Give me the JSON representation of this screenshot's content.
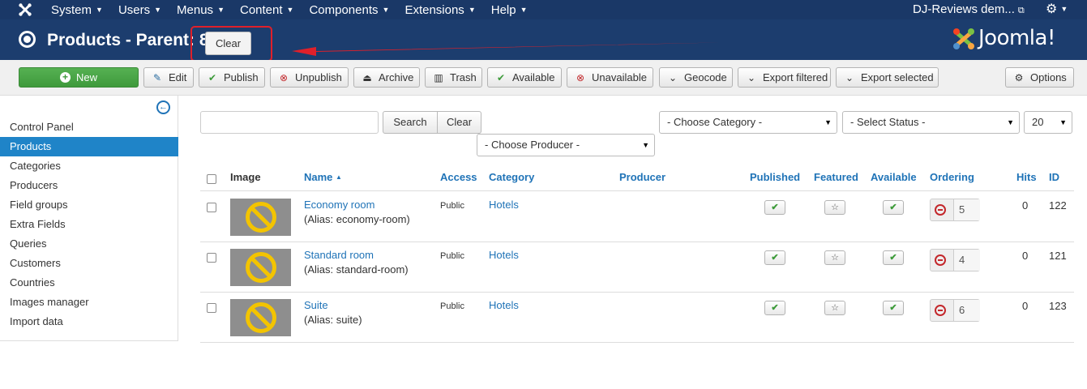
{
  "topnav": {
    "menu": [
      {
        "label": "System"
      },
      {
        "label": "Users"
      },
      {
        "label": "Menus"
      },
      {
        "label": "Content"
      },
      {
        "label": "Components"
      },
      {
        "label": "Extensions"
      },
      {
        "label": "Help"
      }
    ],
    "site_label": "DJ-Reviews dem...",
    "bg_color": "#1a3867"
  },
  "header": {
    "title": "Products - Parent: 89",
    "clear_label": "Clear",
    "logo_text": "Joomla!"
  },
  "toolbar": {
    "new": "New",
    "edit": "Edit",
    "publish": "Publish",
    "unpublish": "Unpublish",
    "archive": "Archive",
    "trash": "Trash",
    "available": "Available",
    "unavailable": "Unavailable",
    "geocode": "Geocode",
    "export_filtered": "Export filtered",
    "export_selected": "Export selected",
    "options": "Options"
  },
  "sidebar": {
    "items": [
      {
        "label": "Control Panel"
      },
      {
        "label": "Products"
      },
      {
        "label": "Categories"
      },
      {
        "label": "Producers"
      },
      {
        "label": "Field groups"
      },
      {
        "label": "Extra Fields"
      },
      {
        "label": "Queries"
      },
      {
        "label": "Customers"
      },
      {
        "label": "Countries"
      },
      {
        "label": "Images manager"
      },
      {
        "label": "Import data"
      }
    ],
    "active_index": 1
  },
  "filters": {
    "search_value": "",
    "search_label": "Search",
    "clear_label": "Clear",
    "category": "- Choose Category -",
    "status": "- Select Status -",
    "limit": "20",
    "producer": "- Choose Producer -"
  },
  "table": {
    "headers": {
      "image": "Image",
      "name": "Name",
      "sort_indicator": "▲",
      "access": "Access",
      "category": "Category",
      "producer": "Producer",
      "published": "Published",
      "featured": "Featured",
      "available": "Available",
      "ordering": "Ordering",
      "hits": "Hits",
      "id": "ID"
    },
    "rows": [
      {
        "name": "Economy room",
        "alias": "(Alias: economy-room)",
        "access": "Public",
        "category": "Hotels",
        "producer": "",
        "ordering": "5",
        "hits": "0",
        "id": "122"
      },
      {
        "name": "Standard room",
        "alias": "(Alias: standard-room)",
        "access": "Public",
        "category": "Hotels",
        "producer": "",
        "ordering": "4",
        "hits": "0",
        "id": "121"
      },
      {
        "name": "Suite",
        "alias": "(Alias: suite)",
        "access": "Public",
        "category": "Hotels",
        "producer": "",
        "ordering": "6",
        "hits": "0",
        "id": "123"
      }
    ]
  },
  "colors": {
    "accent": "#1f84c8",
    "link": "#1f73b7",
    "new_button": "#46a546",
    "annotation": "#e0202a"
  }
}
